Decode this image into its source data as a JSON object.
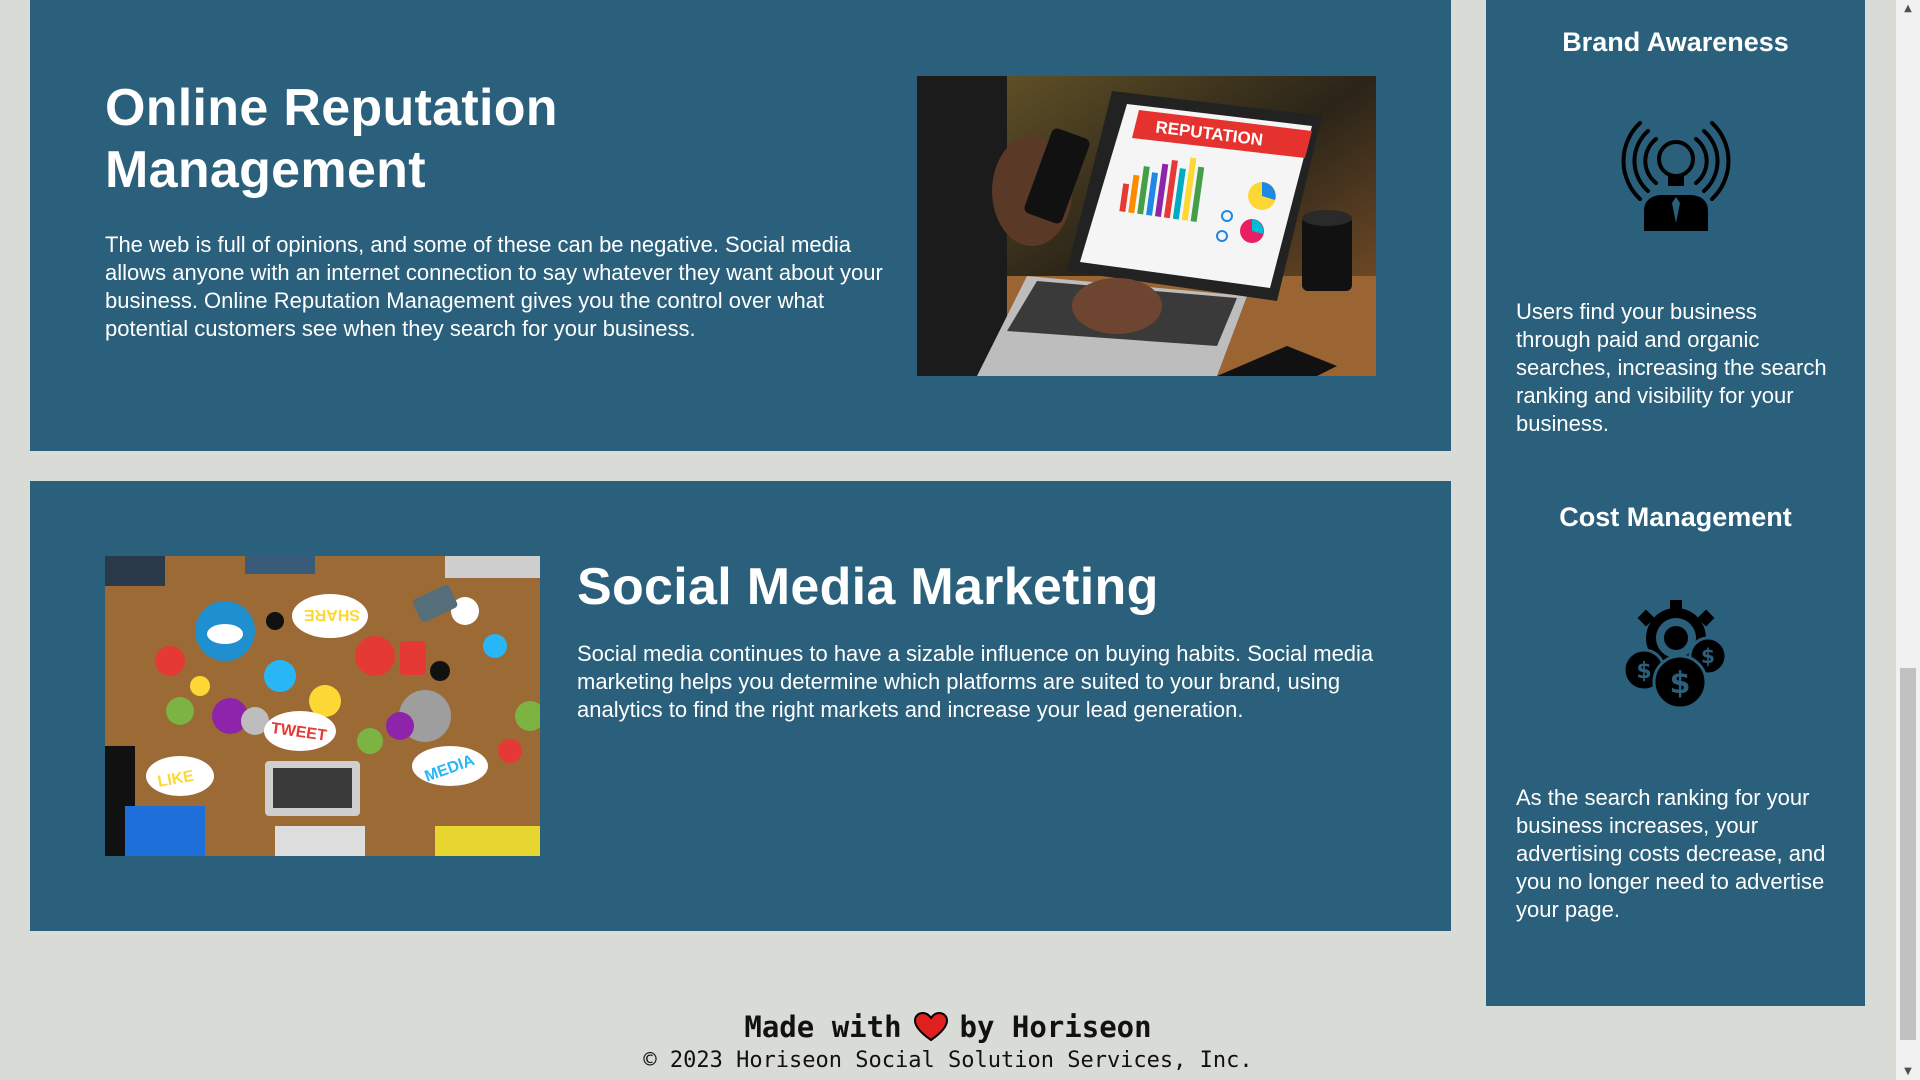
{
  "sections": {
    "orm": {
      "title": "Online Reputation Management",
      "body": "The web is full of opinions, and some of these can be negative. Social media allows anyone with an internet connection to say whatever they want about your business. Online Reputation Management gives you the control over what potential customers see when they search for your business.",
      "image_icon": "laptop-reputation-photo",
      "image_text": "REPUTATION"
    },
    "smm": {
      "title": "Social Media Marketing",
      "body": "Social media continues to have a sizable influence on buying habits. Social media marketing helps you determine which platforms are suited to your brand, using analytics to find the right markets and increase your lead generation.",
      "image_icon": "social-media-collage-photo",
      "image_words": [
        "SHARE",
        "TWEET",
        "LIKE",
        "MEDIA"
      ]
    }
  },
  "benefits": {
    "brand": {
      "title": "Brand Awareness",
      "icon": "broadcast-person-icon",
      "body": "Users find your business through paid and organic searches, increasing the search ranking and visibility for your business."
    },
    "cost": {
      "title": "Cost Management",
      "icon": "cost-gears-icon",
      "body": "As the search ranking for your business increases, your advertising costs decrease, and you no longer need to advertise your page."
    }
  },
  "footer": {
    "made_with": "Made with",
    "by": "by Horiseon",
    "copyright": "© 2023 Horiseon Social Solution Services, Inc.",
    "heart_icon": "heart-icon",
    "heart_color": "#e0201f"
  },
  "colors": {
    "page_background": "#d9dcd6",
    "card_background": "#2a607c",
    "text_on_card": "#ffffff"
  }
}
